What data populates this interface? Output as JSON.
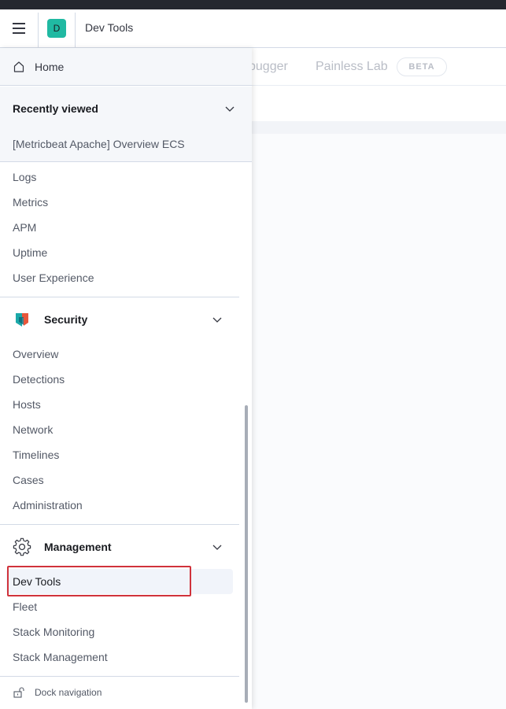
{
  "header": {
    "space_initial": "D",
    "title": "Dev Tools"
  },
  "background": {
    "tabs": [
      "bugger",
      "Painless Lab"
    ],
    "badge": "BETA"
  },
  "nav": {
    "home_label": "Home",
    "recently_viewed": {
      "title": "Recently viewed",
      "items": [
        "[Metricbeat Apache] Overview ECS"
      ]
    },
    "observability_links": [
      "Logs",
      "Metrics",
      "APM",
      "Uptime",
      "User Experience"
    ],
    "security": {
      "title": "Security",
      "links": [
        "Overview",
        "Detections",
        "Hosts",
        "Network",
        "Timelines",
        "Cases",
        "Administration"
      ]
    },
    "management": {
      "title": "Management",
      "links": [
        "Dev Tools",
        "Fleet",
        "Stack Monitoring",
        "Stack Management"
      ],
      "active": "Dev Tools"
    },
    "dock_label": "Dock navigation"
  },
  "colors": {
    "highlight_border": "#d0323b",
    "space_avatar": "#20b9a2",
    "security_logo_teal": "#1ba9a9",
    "security_logo_orange": "#e8573b"
  }
}
